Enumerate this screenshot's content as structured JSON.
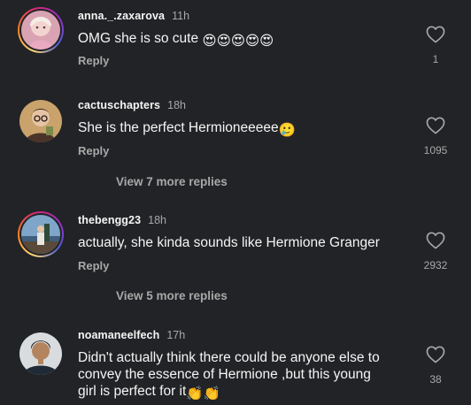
{
  "comments": [
    {
      "username": "anna._.zaxarova",
      "time": "11h",
      "text": "OMG she is so cute",
      "emoji": "😍😍😍😍😍",
      "reply": "Reply",
      "likes": "1"
    },
    {
      "username": "cactuschapters",
      "time": "18h",
      "text": "She is the perfect Hermioneeeee",
      "emoji": "🥲",
      "reply": "Reply",
      "likes": "1095",
      "view_more": "View 7 more replies"
    },
    {
      "username": "thebengg23",
      "time": "18h",
      "text": "actually, she kinda sounds like Hermione Granger",
      "reply": "Reply",
      "likes": "2932",
      "view_more": "View 5 more replies"
    },
    {
      "username": "noamaneelfech",
      "time": "17h",
      "text_line1": "Didn't actually think there could be anyone else to",
      "text_line2": "convey the essence of Hermione ,but this young",
      "text_line3": "girl is perfect for it",
      "emoji": "👏👏",
      "likes": "38"
    }
  ],
  "colors": {
    "background": "#222326",
    "primary_text": "#f5f5f5",
    "secondary_text": "#a8a8a8"
  },
  "icons": {
    "like": "heart-outline-icon"
  }
}
